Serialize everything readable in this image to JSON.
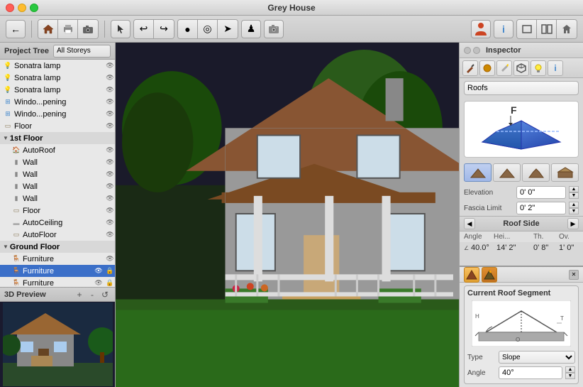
{
  "window": {
    "title": "Grey House",
    "traffic_lights": [
      "close",
      "minimize",
      "maximize"
    ]
  },
  "toolbar": {
    "back_label": "←",
    "tools": [
      "house-icon",
      "printer-icon",
      "camera-icon"
    ],
    "pointer_label": "▲",
    "undo_label": "↩",
    "redo_label": "↪",
    "circle_label": "●",
    "target_label": "◎",
    "arrow_label": "➤",
    "walk_label": "♟",
    "snapshot_label": "📷"
  },
  "left_panel": {
    "header": "Project Tree",
    "dropdown_label": "All Storeys",
    "items": [
      {
        "label": "Sonatra lamp",
        "type": "lamp",
        "indent": 0,
        "has_eye": true,
        "has_lock": false
      },
      {
        "label": "Sonatra lamp",
        "type": "lamp",
        "indent": 0,
        "has_eye": true,
        "has_lock": false
      },
      {
        "label": "Sonatra lamp",
        "type": "lamp",
        "indent": 0,
        "has_eye": true,
        "has_lock": false
      },
      {
        "label": "Windo...pening",
        "type": "window",
        "indent": 0,
        "has_eye": true,
        "has_lock": false
      },
      {
        "label": "Windo...pening",
        "type": "window",
        "indent": 0,
        "has_eye": true,
        "has_lock": false
      },
      {
        "label": "Floor",
        "type": "floor",
        "indent": 0,
        "has_eye": true,
        "has_lock": false
      },
      {
        "label": "1st Floor",
        "type": "folder",
        "indent": 0,
        "is_section": true,
        "expanded": true
      },
      {
        "label": "AutoRoof",
        "type": "roof",
        "indent": 1,
        "has_eye": true,
        "has_lock": false
      },
      {
        "label": "Wall",
        "type": "wall",
        "indent": 1,
        "has_eye": true,
        "has_lock": false
      },
      {
        "label": "Wall",
        "type": "wall",
        "indent": 1,
        "has_eye": true,
        "has_lock": false
      },
      {
        "label": "Wall",
        "type": "wall",
        "indent": 1,
        "has_eye": true,
        "has_lock": false
      },
      {
        "label": "Wall",
        "type": "wall",
        "indent": 1,
        "has_eye": true,
        "has_lock": false
      },
      {
        "label": "Floor",
        "type": "floor",
        "indent": 1,
        "has_eye": true,
        "has_lock": false
      },
      {
        "label": "AutoCeiling",
        "type": "ceiling",
        "indent": 1,
        "has_eye": true,
        "has_lock": false
      },
      {
        "label": "AutoFloor",
        "type": "floor",
        "indent": 1,
        "has_eye": true,
        "has_lock": false
      },
      {
        "label": "Ground Floor",
        "type": "folder",
        "indent": 0,
        "is_section": true,
        "expanded": true
      },
      {
        "label": "Furniture",
        "type": "furniture",
        "indent": 1,
        "has_eye": true,
        "has_lock": false
      },
      {
        "label": "Furniture",
        "type": "furniture",
        "indent": 1,
        "has_eye": true,
        "has_lock": false,
        "selected": true
      },
      {
        "label": "Furniture",
        "type": "furniture",
        "indent": 1,
        "has_eye": true,
        "has_lock": true
      }
    ]
  },
  "preview": {
    "title": "3D Preview",
    "zoom_in": "+",
    "zoom_out": "-",
    "reset": "↺"
  },
  "inspector": {
    "title": "Inspector",
    "tools": [
      "brush-icon",
      "circle-icon",
      "pencil-icon",
      "cube-icon",
      "bulb-icon",
      "info-icon"
    ],
    "dropdown_label": "Roofs",
    "roof_styles": [
      "style1",
      "style2",
      "style3",
      "style4"
    ],
    "elevation_label": "Elevation",
    "elevation_value": "0' 0\"",
    "fascia_label": "Fascia Limit",
    "fascia_value": "0' 2\"",
    "roof_side": {
      "label": "Roof Side",
      "angle_col": "Angle",
      "hei_col": "Hei...",
      "th_col": "Th.",
      "ov_col": "Ov.",
      "angle_val": "40.0°",
      "hei_val": "14' 2\"",
      "th_val": "0' 8\"",
      "ov_val": "1' 0\""
    }
  },
  "bottom_inspector": {
    "title": "Current Roof Segment",
    "close_label": "✕",
    "bottom_icons": [
      "roof-icon",
      "pencil-roof-icon"
    ],
    "type_label": "Type",
    "type_value": "Slope",
    "angle_label": "Angle",
    "angle_value": "40°"
  }
}
